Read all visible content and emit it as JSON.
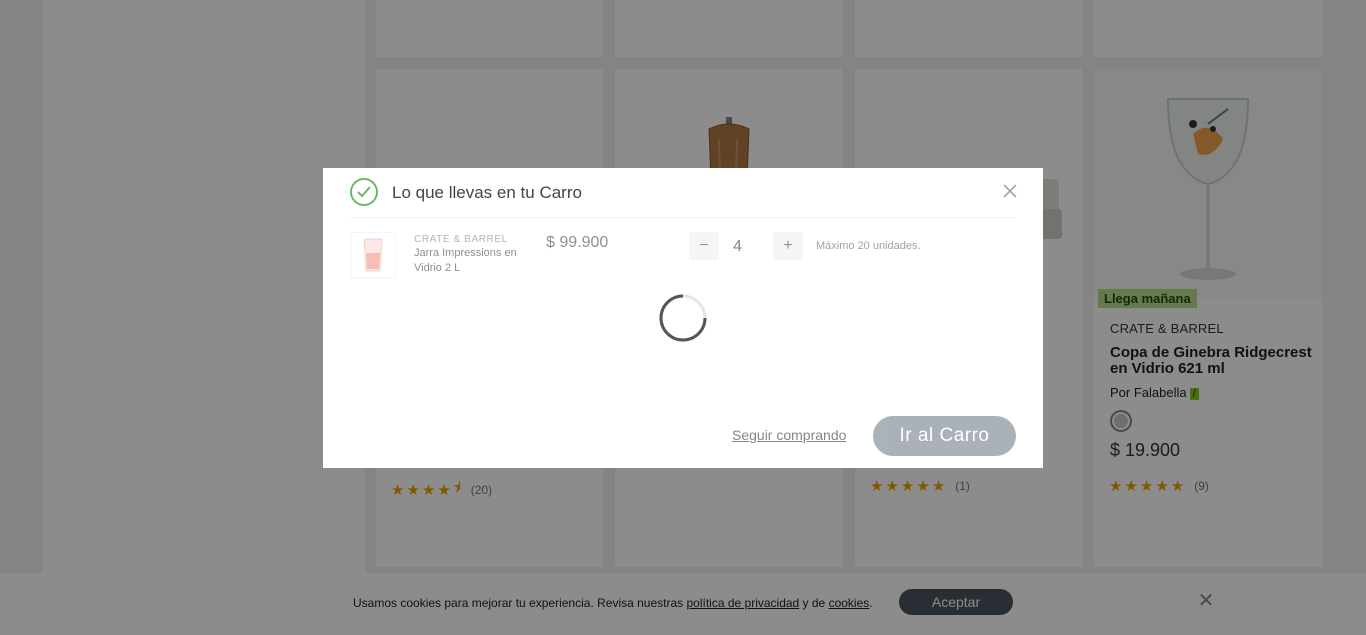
{
  "products": [
    {
      "rating_count": "(20)",
      "stars": 4.5
    },
    {
      "rating_count": "",
      "stars": 0
    },
    {
      "rating_count": "(1)",
      "stars": 5
    },
    {
      "badge": "Llega mañana",
      "brand": "CRATE & BARREL",
      "name": "Copa de Ginebra Ridgecrest en Vidrio 621 ml",
      "seller": "Por Falabella",
      "seller_tag": "/",
      "price": "$ 19.900",
      "rating_count": "(9)",
      "stars": 5
    }
  ],
  "modal": {
    "title": "Lo que llevas en tu Carro",
    "item": {
      "brand": "CRATE & BARREL",
      "name": "Jarra Impressions en Vidrio 2 L",
      "price": "$ 99.900",
      "qty_minus": "−",
      "quantity": "4",
      "qty_plus": "+",
      "max_note": "Máximo 20 unidades."
    },
    "keep_shopping": "Seguir comprando",
    "go_to_cart": "Ir al Carro"
  },
  "cookie_bar": {
    "text_before": "Usamos cookies para mejorar tu experiencia. Revisa nuestras ",
    "privacy_link": "política de privacidad",
    "text_mid": " y de ",
    "cookies_link": "cookies",
    "text_after": ".",
    "accept_label": "Aceptar",
    "close_label": "✕"
  },
  "colors": {
    "accent_green": "#6bb86a",
    "badge_green": "#b8e08c",
    "star": "#e8a100",
    "button_dark": "#4a5560"
  },
  "icons": [
    "check-circle-icon",
    "close-icon",
    "loading-spinner-icon",
    "star-icon",
    "star-half-icon"
  ]
}
